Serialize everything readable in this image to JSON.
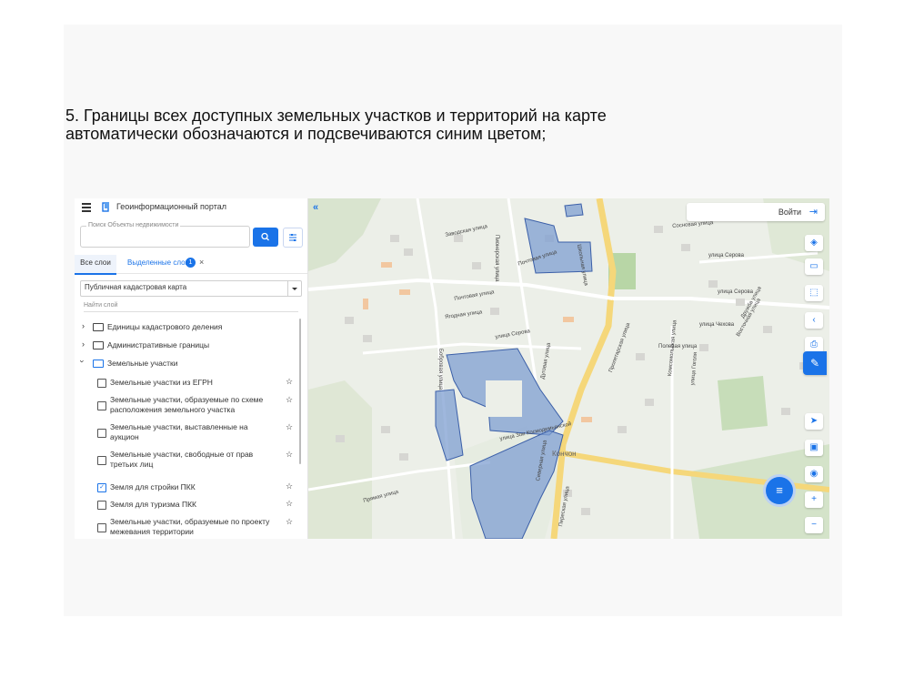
{
  "caption": {
    "line1": "5. Границы всех доступных земельных участков и территорий на карте",
    "line2": "автоматически обозначаются и подсвечиваются синим цветом;"
  },
  "header": {
    "title": "Геоинформационный портал"
  },
  "search": {
    "label": "Поиск Объекты недвижимости"
  },
  "tabs": {
    "all": "Все слои",
    "selected": "Выделенные слои",
    "selected_count": "1",
    "close": "×"
  },
  "basemap": {
    "value": "Публичная кадастровая карта"
  },
  "find_layer": {
    "placeholder": "Найти слой"
  },
  "tree": {
    "folders": [
      {
        "label": "Единицы кадастрового деления"
      },
      {
        "label": "Административные границы"
      },
      {
        "label": "Земельные участки"
      }
    ],
    "layers": [
      {
        "label": "Земельные участки из ЕГРН",
        "checked": false
      },
      {
        "label": "Земельные участки, образуемые по схеме расположения земельного участка",
        "checked": false
      },
      {
        "label": "Земельные участки, выставленные на аукцион",
        "checked": false
      },
      {
        "label": "Земельные участки, свободные от прав третьих лиц",
        "checked": false
      },
      {
        "label": "Земля для стройки ПКК",
        "checked": true
      },
      {
        "label": "Земля для туризма ПКК",
        "checked": false
      },
      {
        "label": "Земельные участки, образуемые по проекту межевания территории",
        "checked": false
      }
    ]
  },
  "map": {
    "login": "Войти",
    "parcel_color": "#7f9fd2",
    "streets": [
      "Заводская улица",
      "Почтовая улица",
      "Почтовая улица",
      "Ягодная улица",
      "улица Серова",
      "улица Серова",
      "улица Серова",
      "Полевая улица",
      "улица Чехова",
      "Восточная улица",
      "Комсомольская улица",
      "Пионерская улица",
      "Бобровая улица",
      "Дуговая улица",
      "Пролетарская улица",
      "улица Зои Космодемьянской",
      "Прямая улица",
      "Северная улица",
      "Переская улица",
      "Школьная улица",
      "Сосновая улица",
      "улица Гоголя",
      "Дружба улица"
    ],
    "district_label": "Кончон"
  }
}
